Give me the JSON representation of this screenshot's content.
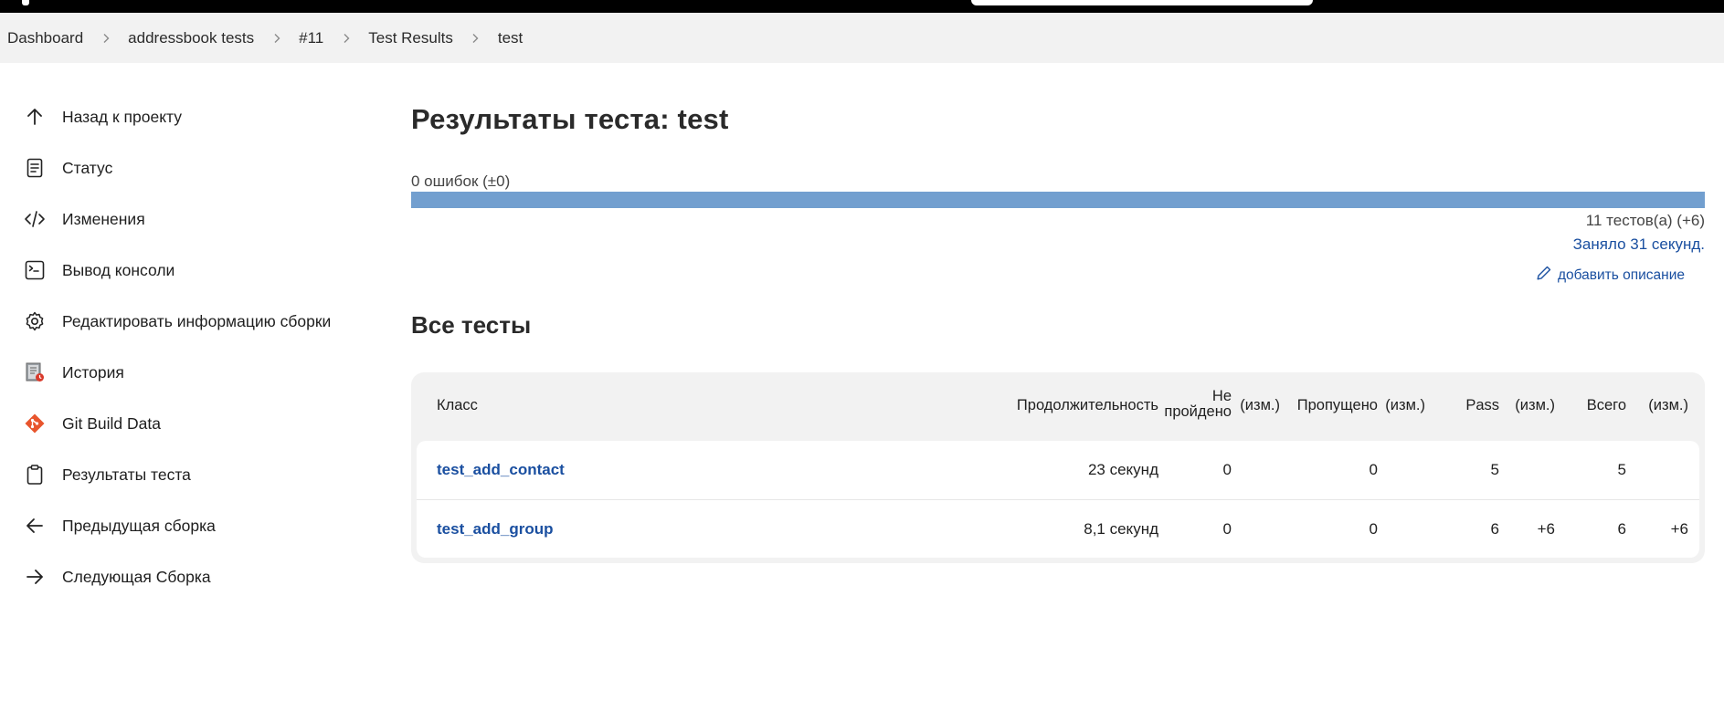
{
  "breadcrumbs": [
    "Dashboard",
    "addressbook tests",
    "#11",
    "Test Results",
    "test"
  ],
  "sidebar": {
    "items": [
      {
        "label": "Назад к проекту",
        "icon": "arrow-up-icon"
      },
      {
        "label": "Статус",
        "icon": "document-icon"
      },
      {
        "label": "Изменения",
        "icon": "code-icon"
      },
      {
        "label": "Вывод консоли",
        "icon": "terminal-icon"
      },
      {
        "label": "Редактировать информацию сборки",
        "icon": "gear-icon"
      },
      {
        "label": "История",
        "icon": "history-icon"
      },
      {
        "label": "Git Build Data",
        "icon": "git-icon"
      },
      {
        "label": "Результаты теста",
        "icon": "clipboard-icon"
      },
      {
        "label": "Предыдущая сборка",
        "icon": "arrow-left-icon"
      },
      {
        "label": "Следующая Сборка",
        "icon": "arrow-right-icon"
      }
    ]
  },
  "main": {
    "title": "Результаты теста: test",
    "fail_summary": "0 ошибок (±0)",
    "pass_fraction": 1.0,
    "tests_count": "11 тестов(а) (+6)",
    "duration": "Заняло 31 секунд.",
    "add_description": "добавить описание",
    "section_title": "Все тесты"
  },
  "table": {
    "headers": {
      "class": "Класс",
      "duration": "Продолжительность",
      "failed_line1": "Не",
      "failed_line2": "пройдено",
      "failed_diff": "(изм.)",
      "skipped": "Пропущено",
      "skipped_diff": "(изм.)",
      "pass": "Pass",
      "pass_diff": "(изм.)",
      "total": "Всего",
      "total_diff": "(изм.)"
    },
    "rows": [
      {
        "class": "test_add_contact",
        "duration": "23 секунд",
        "failed": "0",
        "failed_diff": "",
        "skipped": "0",
        "skipped_diff": "",
        "pass": "5",
        "pass_diff": "",
        "total": "5",
        "total_diff": ""
      },
      {
        "class": "test_add_group",
        "duration": "8,1 секунд",
        "failed": "0",
        "failed_diff": "",
        "skipped": "0",
        "skipped_diff": "",
        "pass": "6",
        "pass_diff": "+6",
        "total": "6",
        "total_diff": "+6"
      }
    ]
  },
  "colors": {
    "progress": "#729fcf",
    "link": "#1a4fa0",
    "git": "#e8552d"
  }
}
